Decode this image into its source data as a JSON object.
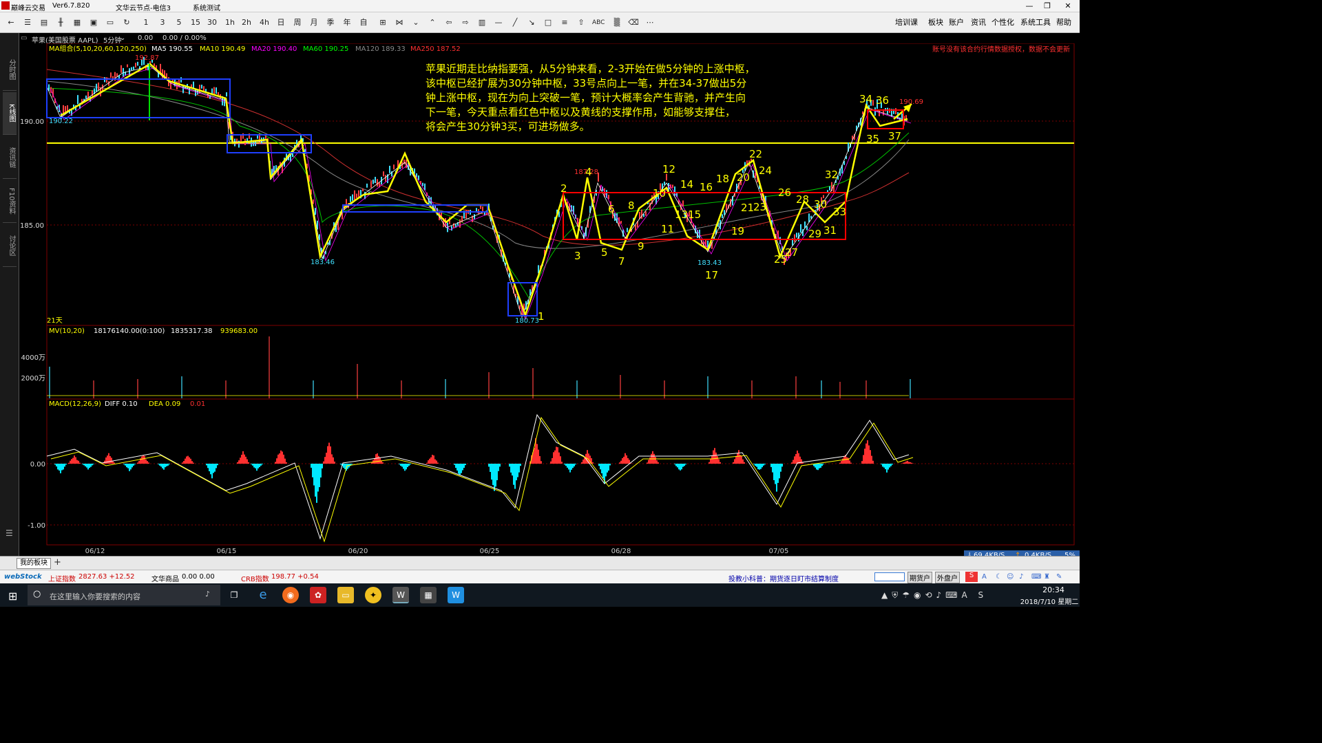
{
  "app": {
    "title": "巅峰云交易",
    "version": "Ver6.7.820",
    "server": "文华云节点-电信3",
    "system_test": "系统测试",
    "win_min": "—",
    "win_restore": "❐",
    "win_close": "✕"
  },
  "toolbar": {
    "periods": [
      "1",
      "3",
      "5",
      "15",
      "30",
      "1h",
      "2h",
      "4h",
      "日",
      "周",
      "月",
      "季",
      "年",
      "自"
    ],
    "abc": "ABC",
    "right_menu": [
      "培训课",
      "板块",
      "账户",
      "资讯",
      "个性化",
      "系统工具",
      "帮助"
    ]
  },
  "infobar": {
    "symbol": "苹果(美国股票 AAPL)",
    "period": "5分钟",
    "price": "0.00",
    "change": "0.00 / 0.00%"
  },
  "side_tabs": [
    "分时图",
    "K线图",
    "资讯链",
    "F10资料",
    "讨论区"
  ],
  "ma_legend": {
    "group": "MA组合(5,10,20,60,120,250)",
    "items": [
      {
        "label": "MA5 190.55",
        "color": "#ffffff"
      },
      {
        "label": "MA10 190.49",
        "color": "#ffff00"
      },
      {
        "label": "MA20 190.40",
        "color": "#ff00ff"
      },
      {
        "label": "MA60 190.25",
        "color": "#00ff00"
      },
      {
        "label": "MA120 189.33",
        "color": "#888888"
      },
      {
        "label": "MA250 187.52",
        "color": "#ff3030"
      }
    ]
  },
  "warning": "账号没有该合约行情数据授权，数据不会更新",
  "annotation": [
    "苹果近期走比纳指要强，从5分钟来看，2-3开始在做5分钟的上涨中枢，",
    "该中枢已经扩展为30分钟中枢，33号点向上一笔，并在34-37做出5分",
    "钟上涨中枢，现在为向上突破一笔，预计大概率会产生背驰，并产生向",
    "下一笔，今天重点看红色中枢以及黄线的支撑作用，如能够支撑住，",
    "将会产生30分钟3买，可进场做多。"
  ],
  "price_axis": [
    "190.00",
    "185.00"
  ],
  "price_labels": {
    "high": "192.87",
    "left": "190.22",
    "low1": "183.46",
    "low2": "180.73",
    "mid": "187.28",
    "low3": "183.43",
    "last": "190.69",
    "days": "21天"
  },
  "wave_numbers": [
    "1",
    "2",
    "3",
    "4",
    "5",
    "6",
    "7",
    "8",
    "9",
    "10",
    "11",
    "12",
    "1315",
    "14",
    "16",
    "17",
    "18",
    "19",
    "20",
    "21",
    "22",
    "23",
    "24",
    "25",
    "26",
    "27",
    "28",
    "29",
    "30",
    "31",
    "32",
    "33",
    "34",
    "35",
    "36",
    "37"
  ],
  "volume": {
    "legend": "MV(10,20)",
    "v1": "18176140.00(0:100)",
    "v2": "1835317.38",
    "v3": "939683.00",
    "ticks": [
      "4000万",
      "2000万"
    ]
  },
  "macd": {
    "legend": "MACD(12,26,9)",
    "diff": "DIFF 0.10",
    "dea": "DEA 0.09",
    "val": "0.01",
    "ticks": [
      "0.00",
      "-1.00"
    ]
  },
  "dates": [
    "06/12",
    "06/15",
    "06/20",
    "06/25",
    "06/28",
    "07/05"
  ],
  "bottom_tab": "我的板块",
  "status": {
    "sh_label": "上证指数",
    "sh_val": "2827.63 +12.52",
    "wh_label": "文华商品",
    "wh_val": "0.00 0.00",
    "crb_label": "CRB指数",
    "crb_val": "198.77 +0.54",
    "tip": "投教小科普：期货逐日盯市结算制度",
    "btn1": "期货户",
    "btn2": "外盘户"
  },
  "net": {
    "down": "69.4KB/S",
    "up": "0.4KB/S",
    "pct": "5%"
  },
  "taskbar": {
    "search": "在这里输入你要搜索的内容",
    "time": "20:34",
    "date": "2018/7/10 星期二"
  }
}
